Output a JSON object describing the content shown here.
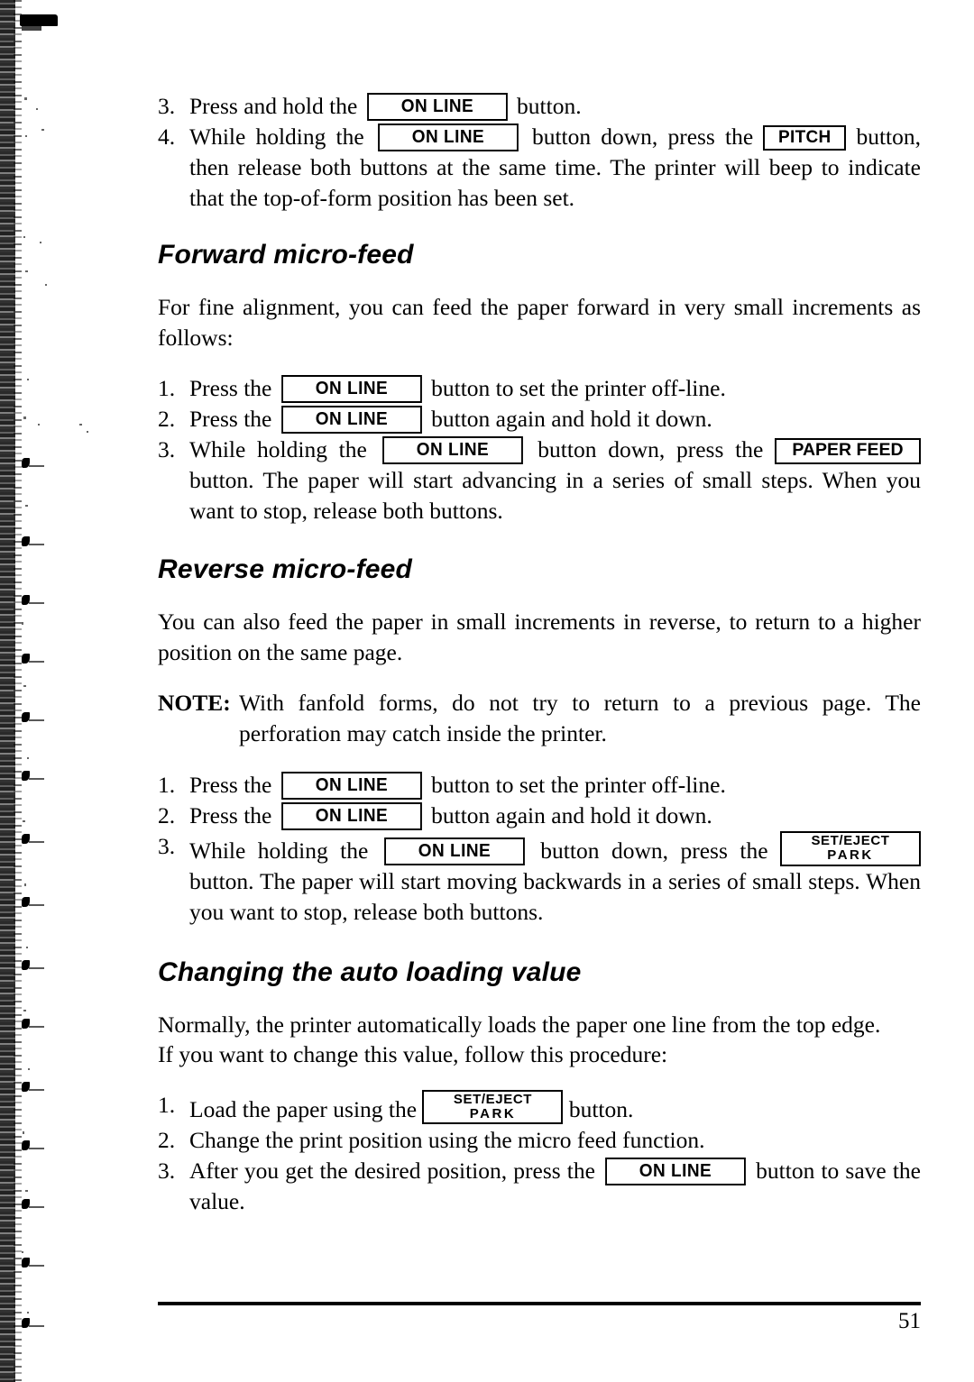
{
  "document": {
    "page_number": "51"
  },
  "keys": {
    "online": "ON LINE",
    "pitch": "PITCH",
    "paper_feed": "PAPER FEED",
    "set_eject_line1": "SET/EJECT",
    "set_eject_line2": "PARK"
  },
  "top_steps": [
    {
      "number": "3.",
      "parts": [
        {
          "type": "text",
          "text": "Press and hold the "
        },
        {
          "type": "key",
          "key": "online"
        },
        {
          "type": "text",
          "text": " button."
        }
      ]
    },
    {
      "number": "4.",
      "parts": [
        {
          "type": "text",
          "text": "While holding the "
        },
        {
          "type": "key",
          "key": "online"
        },
        {
          "type": "text",
          "text": " button down, press the "
        },
        {
          "type": "key",
          "key": "pitch"
        },
        {
          "type": "text",
          "text": " button, then release both buttons at the same time. The printer will beep to indicate that the top-of-form position has been set."
        }
      ]
    }
  ],
  "forward_section": {
    "heading": "Forward micro-feed",
    "intro": "For fine alignment, you can feed the paper forward in very small increments as follows:",
    "steps": [
      {
        "number": "1.",
        "parts": [
          {
            "type": "text",
            "text": "Press the "
          },
          {
            "type": "key",
            "key": "online"
          },
          {
            "type": "text",
            "text": " button to set the printer off-line."
          }
        ]
      },
      {
        "number": "2.",
        "parts": [
          {
            "type": "text",
            "text": "Press the "
          },
          {
            "type": "key",
            "key": "online"
          },
          {
            "type": "text",
            "text": " button again and hold it down."
          }
        ]
      },
      {
        "number": "3.",
        "parts": [
          {
            "type": "text",
            "text": "While holding the "
          },
          {
            "type": "key",
            "key": "online"
          },
          {
            "type": "text",
            "text": " button down, press the "
          },
          {
            "type": "key",
            "key": "paper_feed"
          },
          {
            "type": "text",
            "text": " button. The paper will start advancing in a series of small steps. When you want to stop, release both buttons."
          }
        ]
      }
    ]
  },
  "reverse_section": {
    "heading": "Reverse micro-feed",
    "intro": "You can also feed the paper in small increments in reverse, to return to a higher position on the same page.",
    "note_label": "NOTE:",
    "note_text": "With fanfold forms, do not try to return to a previous page. The perforation may catch inside the printer.",
    "steps": [
      {
        "number": "1.",
        "parts": [
          {
            "type": "text",
            "text": "Press the "
          },
          {
            "type": "key",
            "key": "online"
          },
          {
            "type": "text",
            "text": " button to set the printer off-line."
          }
        ]
      },
      {
        "number": "2.",
        "parts": [
          {
            "type": "text",
            "text": "Press the "
          },
          {
            "type": "key",
            "key": "online"
          },
          {
            "type": "text",
            "text": " button again and hold it down."
          }
        ]
      },
      {
        "number": "3.",
        "parts": [
          {
            "type": "text",
            "text": "While holding the "
          },
          {
            "type": "key",
            "key": "online"
          },
          {
            "type": "text",
            "text": " button down, press the "
          },
          {
            "type": "key",
            "key": "set_eject"
          },
          {
            "type": "text",
            "text": " button. The paper will start moving backwards in a series of small steps. When you want to stop, release both buttons."
          }
        ]
      }
    ]
  },
  "autoload_section": {
    "heading": "Changing the auto loading value",
    "intro_1": "Normally, the printer automatically loads the paper one line from the top edge.",
    "intro_2": "If you want to change this value, follow this procedure:",
    "steps": [
      {
        "number": "1.",
        "parts": [
          {
            "type": "text",
            "text": "Load the paper using the "
          },
          {
            "type": "key",
            "key": "set_eject"
          },
          {
            "type": "text",
            "text": " button."
          }
        ]
      },
      {
        "number": "2.",
        "parts": [
          {
            "type": "text",
            "text": "Change the print position using the micro feed function."
          }
        ]
      },
      {
        "number": "3.",
        "parts": [
          {
            "type": "text",
            "text": "After you get the desired position, press the "
          },
          {
            "type": "key",
            "key": "online"
          },
          {
            "type": "text",
            "text": " button to save the value."
          }
        ]
      }
    ]
  }
}
